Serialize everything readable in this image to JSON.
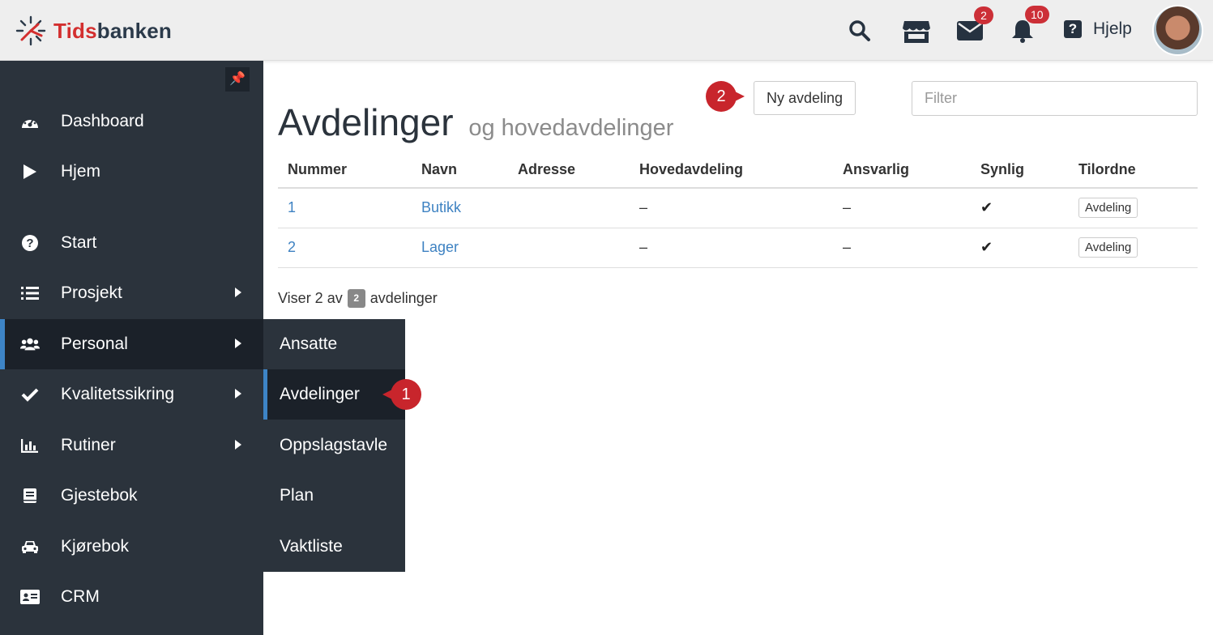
{
  "app": {
    "logo_red": "Tids",
    "logo_dark": "banken"
  },
  "header": {
    "messages_badge": "2",
    "notifications_badge": "10",
    "help_label": "Hjelp",
    "help_glyph": "?"
  },
  "sidebar": {
    "pin_glyph": "📌",
    "items": [
      {
        "label": "Dashboard",
        "icon": "dashboard-gauge-icon"
      },
      {
        "label": "Hjem",
        "icon": "play-icon"
      },
      {
        "label": "Start",
        "icon": "question-circle-icon"
      },
      {
        "label": "Prosjekt",
        "icon": "list-icon"
      },
      {
        "label": "Personal",
        "icon": "users-icon"
      },
      {
        "label": "Kvalitetssikring",
        "icon": "check-icon"
      },
      {
        "label": "Rutiner",
        "icon": "bar-chart-icon"
      },
      {
        "label": "Gjestebok",
        "icon": "book-icon"
      },
      {
        "label": "Kjørebok",
        "icon": "car-icon"
      },
      {
        "label": "CRM",
        "icon": "id-card-icon"
      }
    ]
  },
  "submenu": {
    "items": [
      "Ansatte",
      "Avdelinger",
      "Oppslagstavle",
      "Plan",
      "Vaktliste"
    ]
  },
  "callouts": {
    "first": "1",
    "second": "2"
  },
  "main": {
    "title": "Avdelinger",
    "subtitle": "og hovedavdelinger",
    "new_button": "Ny avdeling",
    "filter_placeholder": "Filter",
    "columns": [
      "Nummer",
      "Navn",
      "Adresse",
      "Hovedavdeling",
      "Ansvarlig",
      "Synlig",
      "Tilordne"
    ],
    "rows": [
      {
        "nummer": "1",
        "navn": "Butikk",
        "adresse": "",
        "hovedavdeling": "–",
        "ansvarlig": "–",
        "synlig": "✔",
        "tilordne": "Avdeling"
      },
      {
        "nummer": "2",
        "navn": "Lager",
        "adresse": "",
        "hovedavdeling": "–",
        "ansvarlig": "–",
        "synlig": "✔",
        "tilordne": "Avdeling"
      }
    ],
    "count_prefix": "Viser 2 av",
    "count_total": "2",
    "count_suffix": "avdelinger"
  },
  "colors": {
    "brand_red": "#d32f2f",
    "sidebar_bg": "#2b333c",
    "active_accent": "#3d84c6",
    "link": "#3e82c2",
    "callout": "#c8252c"
  }
}
